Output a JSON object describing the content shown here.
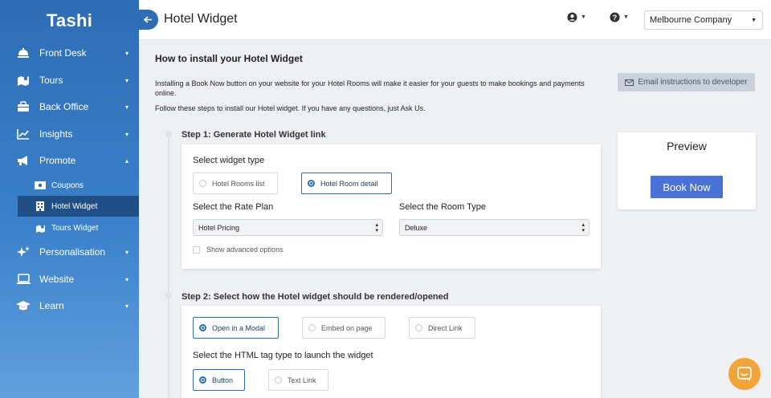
{
  "app": {
    "logo": "Tashi"
  },
  "sidebar": {
    "items": [
      {
        "label": "Front Desk",
        "icon": "bell-icon",
        "caret": "▾"
      },
      {
        "label": "Tours",
        "icon": "map-icon",
        "caret": "▾"
      },
      {
        "label": "Back Office",
        "icon": "briefcase-icon",
        "caret": "▾"
      },
      {
        "label": "Insights",
        "icon": "chart-line-icon",
        "caret": "▾"
      },
      {
        "label": "Promote",
        "icon": "megaphone-icon",
        "caret": "▴"
      },
      {
        "label": "Personalisation",
        "icon": "sparkles-icon",
        "caret": "▾"
      },
      {
        "label": "Website",
        "icon": "laptop-icon",
        "caret": "▾"
      },
      {
        "label": "Learn",
        "icon": "graduation-cap-icon",
        "caret": "▾"
      }
    ],
    "sub_items": [
      {
        "label": "Coupons",
        "icon": "ticket-icon"
      },
      {
        "label": "Hotel Widget",
        "icon": "building-icon"
      },
      {
        "label": "Tours Widget",
        "icon": "map-icon"
      }
    ]
  },
  "topbar": {
    "title": "Hotel Widget",
    "company": "Melbourne Company",
    "user_icon": "user-circle-icon",
    "help_icon": "question-circle-icon"
  },
  "main": {
    "heading": "How to install your Hotel Widget",
    "intro": "Installing a Book Now button on your website for your Hotel Rooms will make it easier for your guests to make bookings and payments online.",
    "intro2": "Follow these steps to install our Hotel widget. If you have any questions, just Ask Us.",
    "email_button": "Email instructions to developer",
    "step1": {
      "title": "Step 1: Generate Hotel Widget link",
      "widget_type_label": "Select widget type",
      "widget_types": [
        "Hotel Rooms list",
        "Hotel Room detail"
      ],
      "selected_widget_type": "Hotel Room detail",
      "rate_plan_label": "Select the Rate Plan",
      "rate_plan_value": "Hotel Pricing",
      "room_type_label": "Select the Room Type",
      "room_type_value": "Deluxe",
      "advanced_label": "Show advanced options"
    },
    "step2": {
      "title": "Step 2: Select how the Hotel widget should be rendered/opened",
      "render_options": [
        "Open in a Modal",
        "Embed on page",
        "Direct Link"
      ],
      "selected_render": "Open in a Modal",
      "tag_label": "Select the HTML tag type to launch the widget",
      "tag_options": [
        "Button",
        "Text Link"
      ],
      "selected_tag": "Button"
    },
    "preview": {
      "title": "Preview",
      "button": "Book Now"
    }
  },
  "colors": {
    "primary": "#2e6db4",
    "book_button": "#4a72d4",
    "chat": "#f2a33a"
  }
}
